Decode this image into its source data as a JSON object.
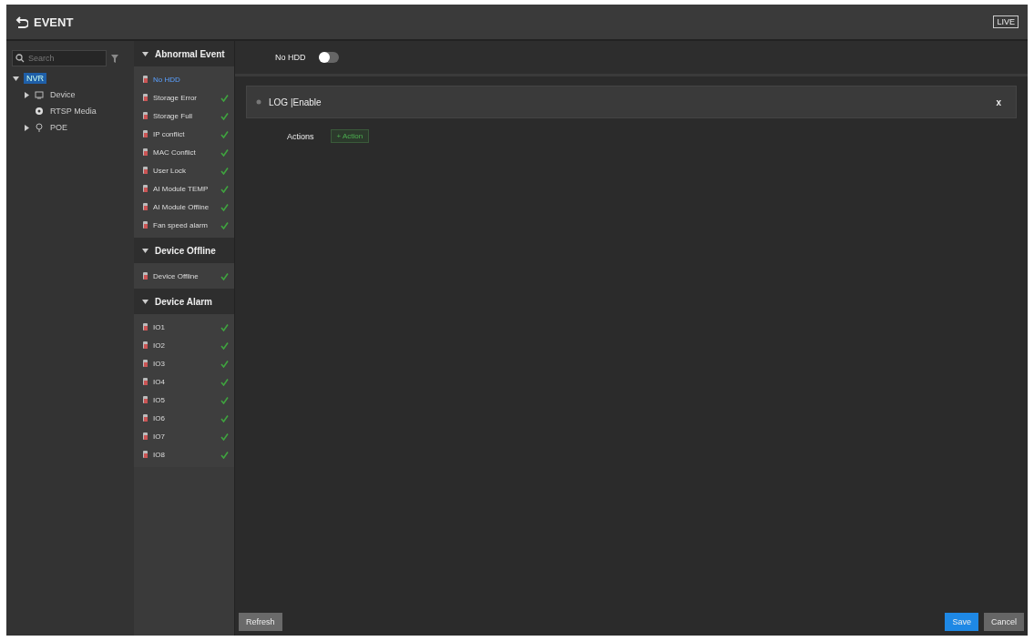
{
  "header": {
    "title": "EVENT",
    "live_button": "LIVE"
  },
  "tree": {
    "search_placeholder": "Search",
    "nodes": [
      {
        "label": "NVR",
        "expanded": true,
        "selected": true,
        "children": [
          {
            "label": "Device",
            "expanded": false,
            "selected": false
          },
          {
            "label": "RTSP Media",
            "selected": false
          },
          {
            "label": "POE",
            "expanded": false,
            "selected": false
          }
        ]
      }
    ]
  },
  "event_groups": [
    {
      "title": "Abnormal Event",
      "expanded": true,
      "items": [
        {
          "label": "No HDD",
          "selected": true,
          "enabled": false
        },
        {
          "label": "Storage Error",
          "selected": false,
          "enabled": true
        },
        {
          "label": "Storage Full",
          "selected": false,
          "enabled": true
        },
        {
          "label": "IP conflict",
          "selected": false,
          "enabled": true
        },
        {
          "label": "MAC Conflict",
          "selected": false,
          "enabled": true
        },
        {
          "label": "User Lock",
          "selected": false,
          "enabled": true
        },
        {
          "label": "AI Module TEMP",
          "selected": false,
          "enabled": true
        },
        {
          "label": "AI Module Offline",
          "selected": false,
          "enabled": true
        },
        {
          "label": "Fan speed alarm",
          "selected": false,
          "enabled": true
        }
      ]
    },
    {
      "title": "Device Offline",
      "expanded": true,
      "items": [
        {
          "label": "Device Offline",
          "selected": false,
          "enabled": true
        }
      ]
    },
    {
      "title": "Device Alarm",
      "expanded": true,
      "items": [
        {
          "label": "IO1",
          "selected": false,
          "enabled": true
        },
        {
          "label": "IO2",
          "selected": false,
          "enabled": true
        },
        {
          "label": "IO3",
          "selected": false,
          "enabled": true
        },
        {
          "label": "IO4",
          "selected": false,
          "enabled": true
        },
        {
          "label": "IO5",
          "selected": false,
          "enabled": true
        },
        {
          "label": "IO6",
          "selected": false,
          "enabled": true
        },
        {
          "label": "IO7",
          "selected": false,
          "enabled": true
        },
        {
          "label": "IO8",
          "selected": false,
          "enabled": true
        }
      ]
    }
  ],
  "content": {
    "switch_label": "No HDD",
    "switch_on": false,
    "panel": {
      "title": "LOG |Enable",
      "close": "x",
      "actions_label": "Actions",
      "add_action": "+ Action"
    }
  },
  "footer": {
    "refresh": "Refresh",
    "save": "Save",
    "cancel": "Cancel"
  }
}
